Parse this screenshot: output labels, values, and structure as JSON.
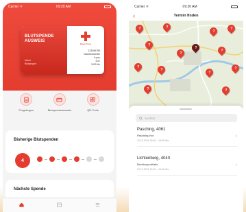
{
  "left_screen": {
    "status": {
      "carrier": "Carrier ᯤ",
      "time": "09:20 AM"
    },
    "card": {
      "title": "BLUTSPENDE\nAUSWEIS",
      "subtitle": "Name\nBlutgruppe",
      "brand": "Rotes Kreuz",
      "details": [
        "123456789",
        "Sachbearbeiter",
        "A pos",
        "4,5 l",
        "1000 Hz"
      ]
    },
    "quick_actions": [
      {
        "label": "Fragebogen",
        "icon": "document-icon"
      },
      {
        "label": "Blutspendeausweis",
        "icon": "card-icon"
      },
      {
        "label": "QR-Code",
        "icon": "qr-icon"
      }
    ],
    "donations": {
      "heading": "Bisherige Blutspenden",
      "count": "4",
      "filled": 4,
      "total": 6
    },
    "next": {
      "heading": "Nächste Spende"
    },
    "tabs": [
      {
        "name": "home",
        "icon": "home-icon"
      },
      {
        "name": "calendar",
        "icon": "calendar-icon"
      },
      {
        "name": "more",
        "icon": "more-icon"
      }
    ]
  },
  "right_screen": {
    "status": {
      "carrier": "Carrier ᯤ",
      "time": "09:20 AM"
    },
    "nav": {
      "back": "‹",
      "title": "Termin finden"
    },
    "search_placeholder": "Suchen",
    "entries": [
      {
        "place": "Pasching, 4061",
        "venue": "Pasching-Hof",
        "time": "12.12.2021 10:00 – 14:00 Uhr"
      },
      {
        "place": "Lichtenberg, 4040",
        "venue": "Bezirkssporthalle",
        "time": "12.12.2021 10:00 – 14:00 Uhr"
      }
    ]
  },
  "colors": {
    "accent": "#e43d30",
    "map": "#e7ecd9"
  }
}
